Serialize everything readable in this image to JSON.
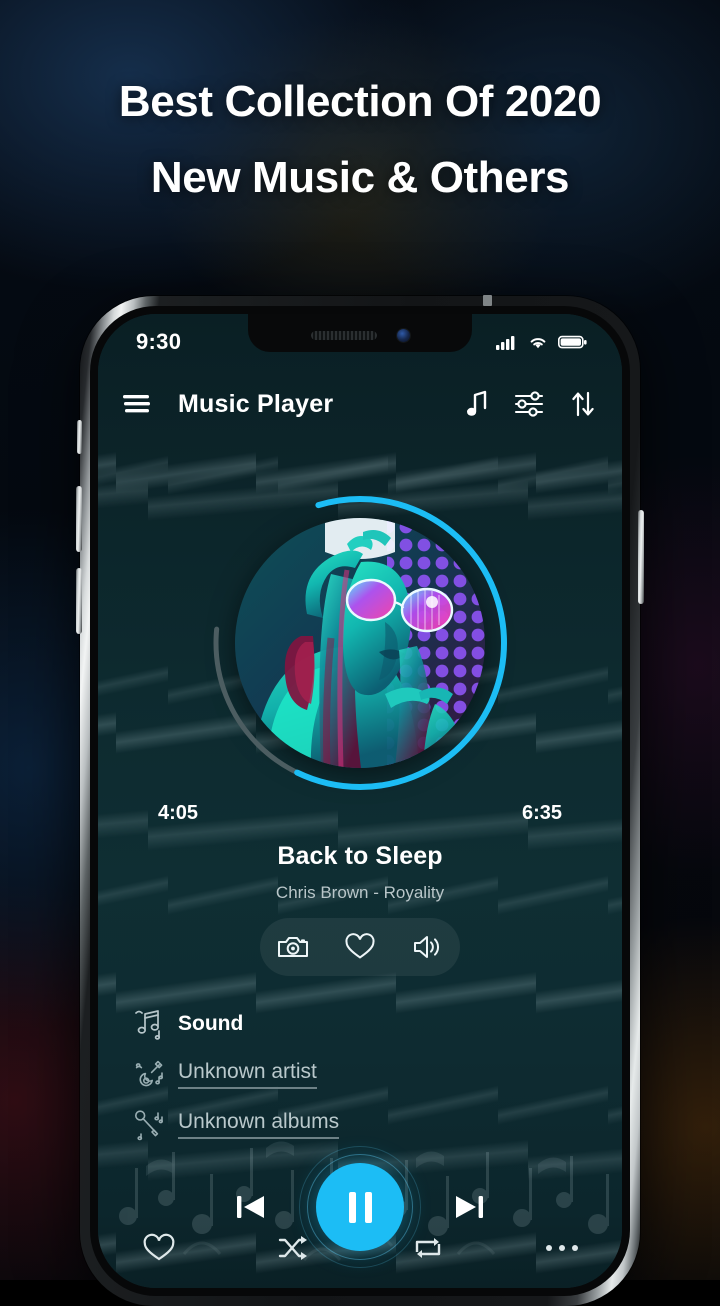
{
  "promo": {
    "headline_line1": "Best Collection Of 2020",
    "headline_line2": "New Music & Others"
  },
  "phone": {
    "status_bar": {
      "time": "9:30",
      "signal_icon": "cellular-signal-icon",
      "wifi_icon": "wifi-icon",
      "battery_icon": "battery-full-icon"
    },
    "hardware": {
      "speaker_grille": "earpiece-speaker",
      "front_camera": "front-camera-icon",
      "mute_switch": "mute-switch",
      "volume_up": "volume-up-button",
      "volume_down": "volume-down-button",
      "power_button": "power-button"
    }
  },
  "app": {
    "appbar": {
      "menu_icon": "hamburger-menu-icon",
      "title": "Music Player",
      "actions": [
        {
          "icon": "music-note-icon",
          "name": "music-note-button"
        },
        {
          "icon": "equalizer-icon",
          "name": "equalizer-button"
        },
        {
          "icon": "sort-arrows-icon",
          "name": "sort-button"
        }
      ]
    },
    "player": {
      "elapsed_time": "4:05",
      "total_time": "6:35",
      "progress_percent": 62,
      "progress_color": "#1cbdf5",
      "progress_track_color": "#4c5d61",
      "artwork_alt": "album-artwork-neon-woman-sunglasses",
      "track_title": "Back to Sleep",
      "track_subtitle": "Chris Brown - Royality",
      "is_playing": true,
      "play_button_color": "#1cbdf5"
    },
    "quick_actions": [
      {
        "icon": "camera-icon",
        "name": "camera-button"
      },
      {
        "icon": "heart-icon",
        "name": "favorite-button"
      },
      {
        "icon": "volume-icon",
        "name": "volume-button"
      }
    ],
    "library_list": [
      {
        "icon": "music-notes-icon",
        "label": "Sound",
        "style": "primary"
      },
      {
        "icon": "guitar-icon",
        "label": "Unknown artist",
        "style": "link"
      },
      {
        "icon": "microphone-icon",
        "label": "Unknown albums",
        "style": "link"
      }
    ],
    "transport": {
      "previous_icon": "skip-previous-icon",
      "play_pause_icon": "pause-icon",
      "next_icon": "skip-next-icon"
    },
    "bottom_nav": [
      {
        "icon": "heart-icon",
        "name": "nav-favorites"
      },
      {
        "icon": "shuffle-icon",
        "name": "nav-shuffle"
      },
      {
        "icon": "repeat-icon",
        "name": "nav-repeat"
      },
      {
        "icon": "more-icon",
        "name": "nav-more"
      }
    ]
  }
}
